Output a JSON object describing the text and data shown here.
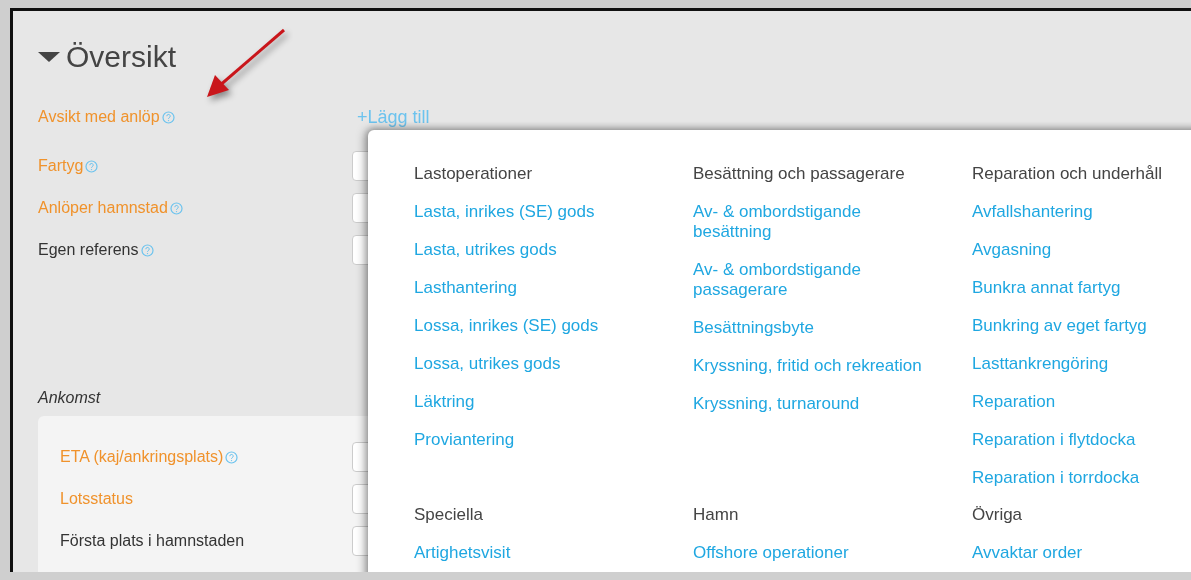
{
  "section": {
    "title": "Översikt",
    "expanded": true
  },
  "fields": [
    {
      "label": "Avsikt med anlöp",
      "required": true,
      "help": true,
      "kind": "link",
      "action": "+Lägg till"
    },
    {
      "label": "Fartyg",
      "required": true,
      "help": true,
      "kind": "input"
    },
    {
      "label": "Anlöper hamnstad",
      "required": true,
      "help": true,
      "kind": "input"
    },
    {
      "label": "Egen referens",
      "required": false,
      "help": true,
      "kind": "input"
    }
  ],
  "arrival": {
    "title": "Ankomst",
    "fields": [
      {
        "label": "ETA (kaj/ankringsplats)",
        "required": true,
        "help": true,
        "kind": "input"
      },
      {
        "label": "Lotsstatus",
        "required": true,
        "help": false,
        "kind": "input"
      },
      {
        "label": "Första plats i hamnstaden",
        "required": false,
        "help": false,
        "kind": "input"
      }
    ]
  },
  "popup": {
    "groups": [
      {
        "heading": "Lastoperationer",
        "items": [
          "Lasta, inrikes (SE) gods",
          "Lasta, utrikes gods",
          "Lasthantering",
          "Lossa, inrikes (SE) gods",
          "Lossa, utrikes gods",
          "Läktring",
          "Proviantering"
        ]
      },
      {
        "heading": "Besättning och passagerare",
        "items": [
          "Av- & ombordstigande besättning",
          "Av- & ombordstigande passagerare",
          "Besättningsbyte",
          "Kryssning, fritid och rekreation",
          "Kryssning, turnaround"
        ]
      },
      {
        "heading": "Reparation och underhåll",
        "items": [
          "Avfallshantering",
          "Avgasning",
          "Bunkra annat fartyg",
          "Bunkring av eget fartyg",
          "Lasttankrengöring",
          "Reparation",
          "Reparation i flytdocka",
          "Reparation i torrdocka"
        ]
      },
      {
        "heading": "Speciella",
        "items": [
          "Artighetsvisit"
        ]
      },
      {
        "heading": "Hamn",
        "items": [
          "Offshore operationer"
        ]
      },
      {
        "heading": "Övriga",
        "items": [
          "Avvaktar order"
        ]
      }
    ]
  }
}
